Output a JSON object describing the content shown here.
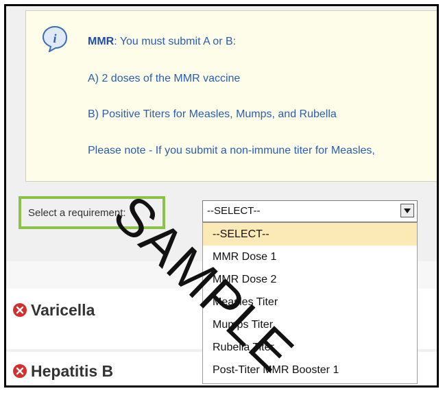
{
  "info": {
    "title_bold": "MMR",
    "title_rest": ": You must submit A or B:",
    "line_a": "A) 2 doses of the MMR vaccine",
    "line_b": "B) Positive Titers for Measles, Mumps, and Rubella",
    "note": "Please note - If you submit a non-immune titer for Measles,"
  },
  "requirement": {
    "label": "Select a requirement:",
    "selected": "--SELECT--",
    "options": [
      "--SELECT--",
      "MMR Dose 1",
      "MMR Dose 2",
      "Measles Titer",
      "Mumps Titer",
      "Rubella Titer",
      "Post-Titer MMR Booster 1"
    ]
  },
  "sections": [
    {
      "title": "Varicella",
      "status_icon": "red-x-circle"
    },
    {
      "title": "Hepatitis B",
      "status_icon": "red-x-circle"
    }
  ],
  "watermark": "SAMPLE",
  "colors": {
    "info_text": "#2a5db0",
    "highlight_border": "#8bc34a",
    "selected_option_bg": "#fbe9b6",
    "status_red": "#d32f2f"
  }
}
